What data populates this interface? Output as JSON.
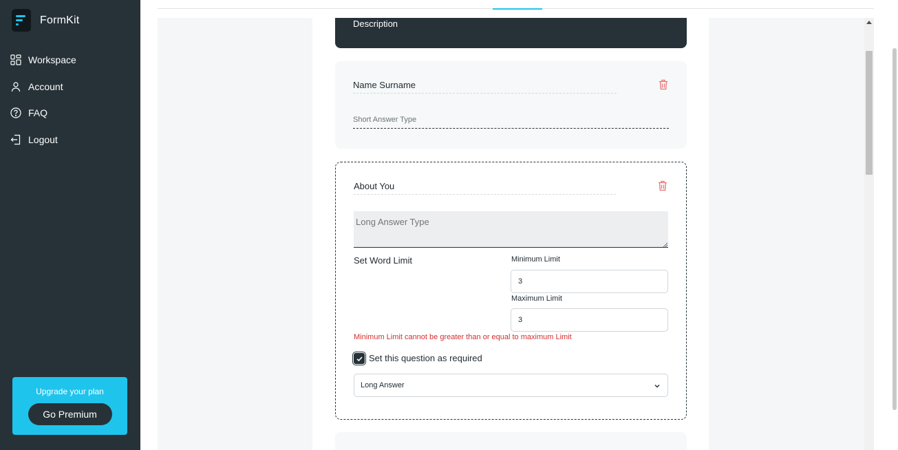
{
  "app": {
    "name": "FormKit",
    "accent_color": "#1fc4ec",
    "sidebar_color": "#263238"
  },
  "sidebar": {
    "items": [
      {
        "label": "Workspace",
        "icon": "grid-icon"
      },
      {
        "label": "Account",
        "icon": "user-icon"
      },
      {
        "label": "FAQ",
        "icon": "question-circle-icon"
      },
      {
        "label": "Logout",
        "icon": "logout-icon"
      }
    ],
    "promo": {
      "title": "Upgrade your plan",
      "button_label": "Go Premium"
    }
  },
  "form": {
    "description_label": "Description",
    "questions": [
      {
        "title": "Name Surname",
        "answer_placeholder": "Short Answer Type"
      },
      {
        "title": "About You",
        "answer_placeholder": "Long Answer Type",
        "word_limit_label": "Set Word Limit",
        "min_label": "Minimum Limit",
        "min_value": "3",
        "max_label": "Maximum Limit",
        "max_value": "3",
        "error_text": "Minimum Limit cannot be greater than or equal to maximum Limit",
        "required_label": "Set this question as required",
        "required_checked": true,
        "type_selected": "Long Answer",
        "error_color": "#d32f2f"
      }
    ]
  }
}
